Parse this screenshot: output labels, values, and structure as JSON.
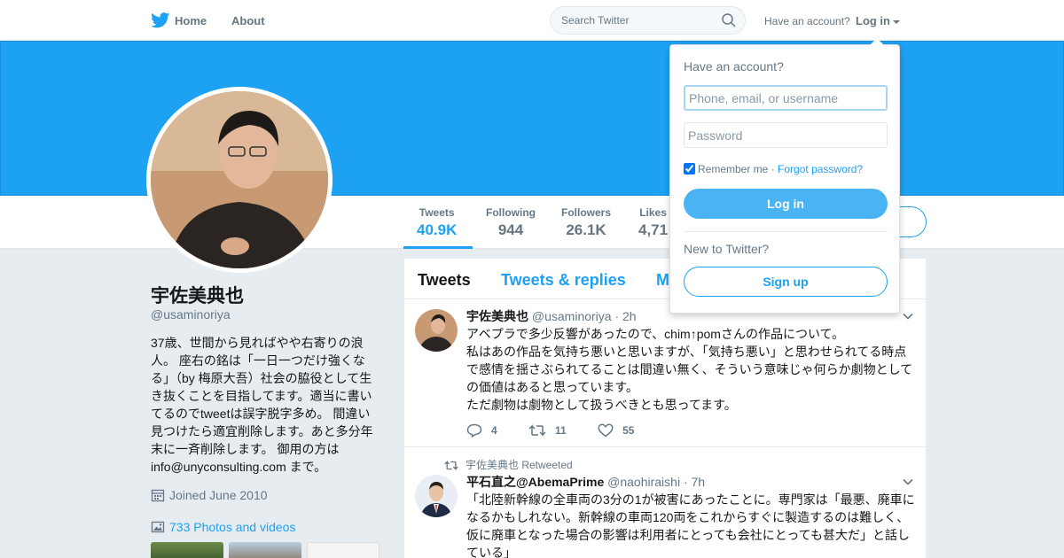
{
  "nav": {
    "home": "Home",
    "about": "About",
    "search_placeholder": "Search Twitter",
    "have_account": "Have an account?",
    "login": "Log in"
  },
  "profile": {
    "name": "宇佐美典也",
    "handle": "@usaminoriya",
    "bio": "37歳、世間から見ればやや右寄りの浪人。 座右の銘は「一日一つだけ強くなる」（by 梅原大吾）社会の脇役として生き抜くことを目指してます。適当に書いてるのでtweetは誤字脱字多め。 間違い見つけたら適宜削除します。あと多分年末に一斉削除します。 御用の方は info@unyconsulting.com まで。",
    "joined": "Joined June 2010",
    "photos": "733 Photos and videos"
  },
  "stats": [
    {
      "label": "Tweets",
      "value": "40.9K"
    },
    {
      "label": "Following",
      "value": "944"
    },
    {
      "label": "Followers",
      "value": "26.1K"
    },
    {
      "label": "Likes",
      "value": "4,71"
    }
  ],
  "timeline": {
    "tabs": [
      "Tweets",
      "Tweets & replies",
      "M"
    ],
    "tweets": [
      {
        "name": "宇佐美典也",
        "handle": "@usaminoriya",
        "time": "· 2h",
        "text": "アベプラで多少反響があったので、chim↑pomさんの作品について。\n私はあの作品を気持ち悪いと思いますが、「気持ち悪い」と思わせられてる時点で感情を揺さぶられてることは間違い無く、そういう意味じゃ何らか劇物としての価値はあると思っています。\nただ劇物は劇物として扱うべきとも思ってます。",
        "replies": "4",
        "retweets": "11",
        "likes": "55"
      },
      {
        "retweeted_by": "宇佐美典也 Retweeted",
        "name": "平石直之@AbemaPrime",
        "handle": "@naohiraishi",
        "time": "· 7h",
        "text": "「北陸新幹線の全車両の3分の1が被害にあったことに。専門家は「最悪、廃車になるかもしれない。新幹線の車両120両をこれからすぐに製造するのは難しく、仮に廃車となった場合の影響は利用者にとっても会社にとっても甚大だ」と話している」"
      }
    ]
  },
  "login_dropdown": {
    "title": "Have an account?",
    "username_placeholder": "Phone, email, or username",
    "password_placeholder": "Password",
    "remember": "Remember me",
    "separator": "·",
    "forgot": "Forgot password?",
    "login_button": "Log in",
    "new_to_twitter": "New to Twitter?",
    "signup_button": "Sign up"
  },
  "colors": {
    "brand": "#1da1f2",
    "banner": "#1da1f2",
    "login_button": "#4ab3f4"
  }
}
